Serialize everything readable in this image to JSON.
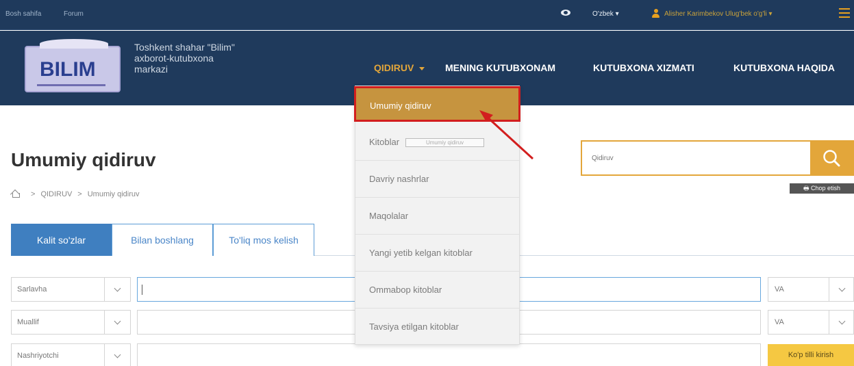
{
  "topbar": {
    "home": "Bosh sahifa",
    "forum": "Forum",
    "language": "O'zbek ▾",
    "user": "Alisher Karimbekov Ulug'bek o'g'li  ▾"
  },
  "header": {
    "logo_text": "BILIM",
    "org_line1": "Toshkent shahar \"Bilim\"",
    "org_line2": "axborot-kutubxona",
    "org_line3": "markazi"
  },
  "nav": [
    {
      "label": "QIDIRUV"
    },
    {
      "label": "MENING KUTUBXONAM"
    },
    {
      "label": "KUTUBXONA XIZMATI"
    },
    {
      "label": "KUTUBXONA HAQIDA"
    }
  ],
  "dropdown": [
    {
      "label": "Umumiy qidiruv"
    },
    {
      "label": "Kitoblar"
    },
    {
      "label": "Davriy nashrlar"
    },
    {
      "label": "Maqolalar"
    },
    {
      "label": "Yangi yetib kelgan kitoblar"
    },
    {
      "label": "Ommabop kitoblar"
    },
    {
      "label": "Tavsiya etilgan kitoblar"
    }
  ],
  "tooltip": "Umumiy qidiruv",
  "page": {
    "title": "Umumiy qidiruv",
    "crumb1": "QIDIRUV",
    "crumb2": "Umumiy qidiruv"
  },
  "search": {
    "placeholder": "Qidiruv",
    "print_label": "Chop etish"
  },
  "tabs": [
    {
      "label": "Kalit so'zlar"
    },
    {
      "label": "Bilan boshlang"
    },
    {
      "label": "To'liq mos kelish"
    }
  ],
  "rows": [
    {
      "field": "Sarlavha",
      "operator": "VA"
    },
    {
      "field": "Muallif",
      "operator": "VA"
    },
    {
      "field": "Nashriyotchi"
    }
  ],
  "multi_lang_button": "Ko'p tilli kirish",
  "colors": {
    "header_bg": "#1f3a5c",
    "accent": "#e3a63a",
    "tab_active": "#3f7fc0",
    "highlight_border": "#d21e1e"
  }
}
